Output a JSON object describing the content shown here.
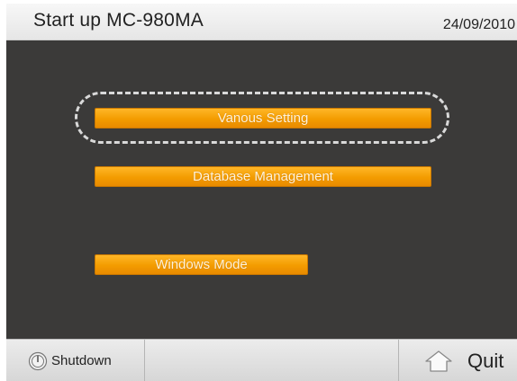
{
  "header": {
    "title": "Start up MC-980MA",
    "date": "24/09/2010"
  },
  "menu": {
    "various_setting": "Vanous Setting",
    "database_management": "Database Management",
    "windows_mode": "Windows Mode"
  },
  "footer": {
    "shutdown_label": "Shutdown",
    "shutdown_icon": "power-icon",
    "quit_label": "Quit",
    "quit_icon": "home-icon"
  },
  "colors": {
    "background": "#3b3a39",
    "button_orange": "#f39c00",
    "highlight_ring": "#d9d9d9"
  }
}
